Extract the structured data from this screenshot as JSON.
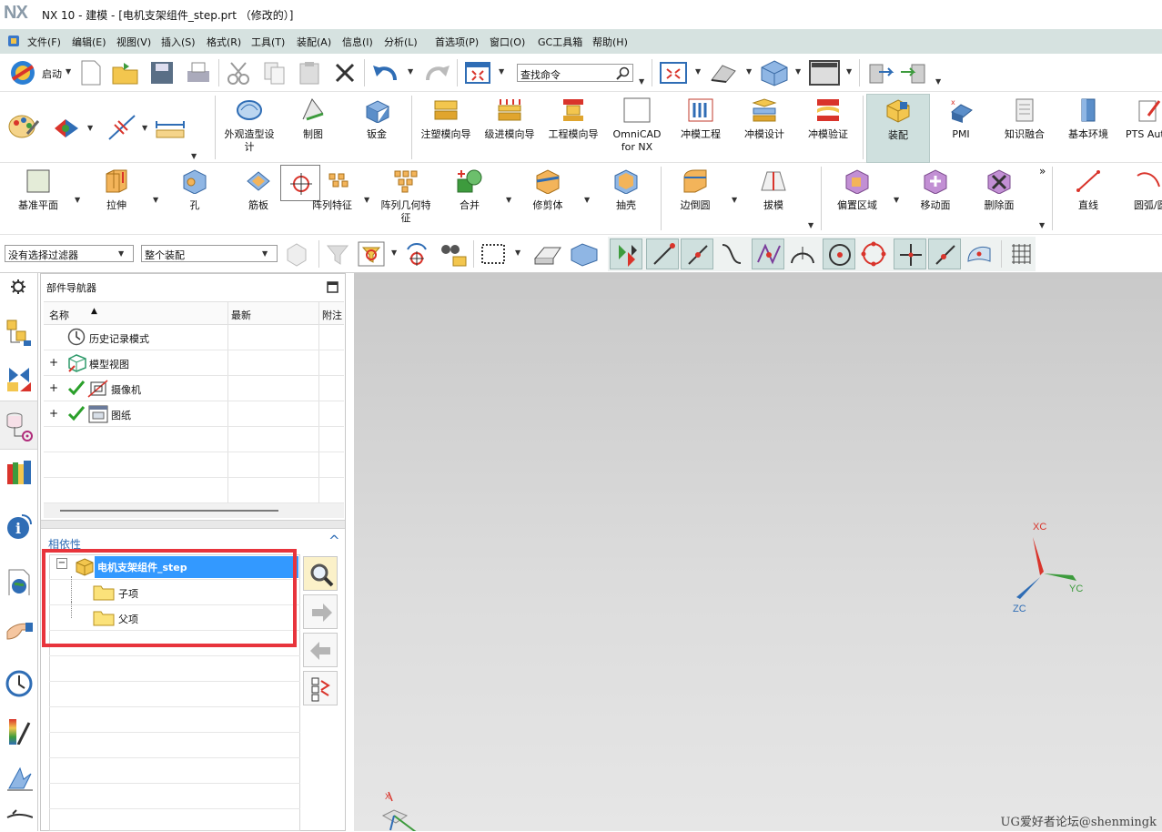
{
  "window": {
    "logo": "NX",
    "title": "NX 10 - 建模 - [电机支架组件_step.prt （修改的）]"
  },
  "menu": [
    "文件(F)",
    "编辑(E)",
    "视图(V)",
    "插入(S)",
    "格式(R)",
    "工具(T)",
    "装配(A)",
    "信息(I)",
    "分析(L)",
    "首选项(P)",
    "窗口(O)",
    "GC工具箱",
    "帮助(H)"
  ],
  "toolbar1": {
    "start_label": "启动",
    "search_placeholder": "查找命令"
  },
  "ribbon_apps": [
    "外观造型设\n计",
    "制图",
    "钣金",
    "注塑模向导",
    "级进模向导",
    "工程模向导",
    "OmniCAD\nfor NX",
    "冲模工程",
    "冲模设计",
    "冲模验证",
    "装配",
    "PMI",
    "知识融合",
    "基本环境",
    "PTS Aut"
  ],
  "ribbon_features": [
    "基准平面",
    "拉伸",
    "孔",
    "筋板",
    "阵列特征",
    "阵列几何特\n征",
    "合并",
    "修剪体",
    "抽壳",
    "边倒圆",
    "拔模",
    "偏置区域",
    "移动面",
    "删除面",
    "直线",
    "圆弧/圆"
  ],
  "filter": {
    "selection_filter": "没有选择过滤器",
    "scope": "整个装配"
  },
  "navigator": {
    "title": "部件导航器",
    "columns": [
      "名称",
      "最新",
      "附注"
    ],
    "items": [
      "历史记录模式",
      "模型视图",
      "摄像机",
      "图纸"
    ]
  },
  "dependency": {
    "title": "相依性",
    "root": "电机支架组件_step",
    "children": [
      "子项",
      "父项"
    ]
  },
  "triad": {
    "x": "XC",
    "y": "YC",
    "z": "ZC",
    "small_x": "X"
  },
  "watermark": "UG爱好者论坛@shenmingk",
  "colors": {
    "menubar": "#d6e2e0",
    "selection": "#3399ff",
    "highlight_box": "#e8343c",
    "accent_link": "#2f6db5"
  }
}
